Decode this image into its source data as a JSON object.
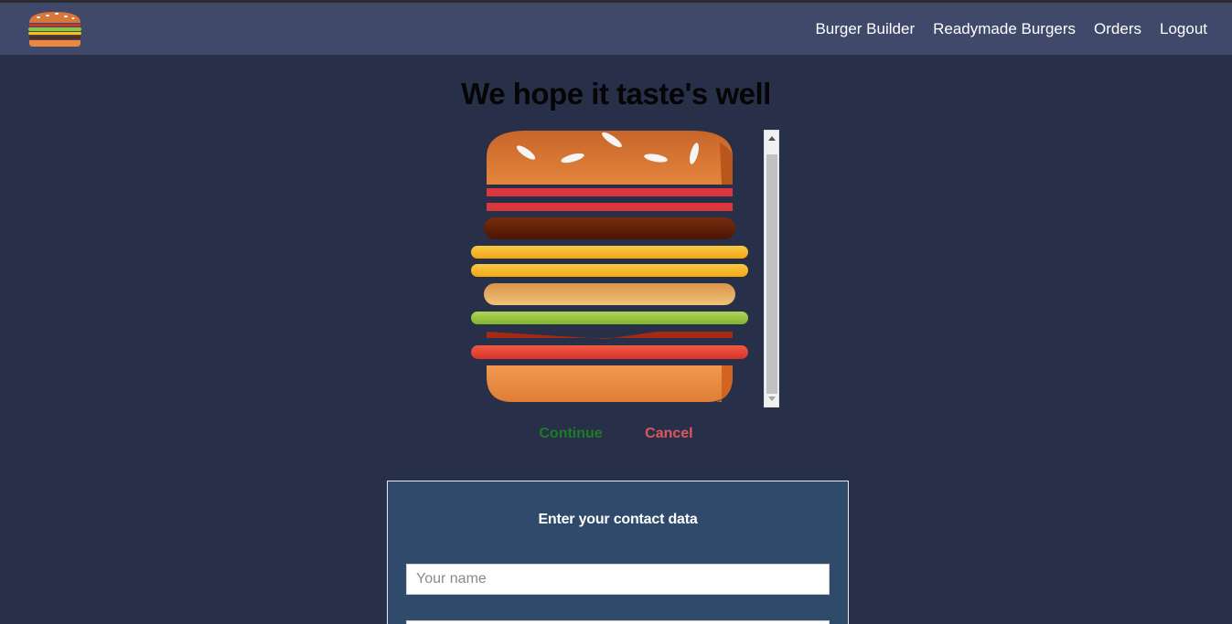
{
  "nav": {
    "logo_icon": "burger-logo-icon",
    "links": [
      "Burger Builder",
      "Readymade Burgers",
      "Orders",
      "Logout"
    ]
  },
  "checkout": {
    "headline": "We hope it taste's well",
    "continue_label": "Continue",
    "cancel_label": "Cancel"
  },
  "contact": {
    "title": "Enter your contact data",
    "name_placeholder": "Your name"
  },
  "colors": {
    "background": "#283049",
    "navbar": "#40496a",
    "continue": "#1c7d25",
    "cancel": "#e0565b",
    "card": "#2f4a6a"
  },
  "burger_layers": [
    "bread-top",
    "bacon",
    "bacon",
    "meat",
    "cheese",
    "cheese",
    "bread-middle",
    "salad",
    "onion",
    "tomato",
    "bread-bottom"
  ]
}
